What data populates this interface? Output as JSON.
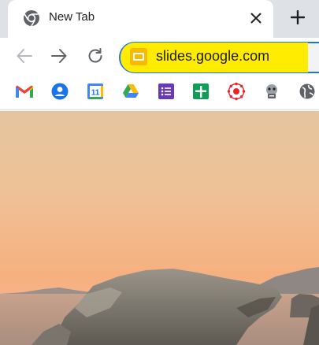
{
  "tab": {
    "title": "New Tab",
    "favicon": "chrome-icon"
  },
  "toolbar": {
    "back_icon": "back-arrow-icon",
    "forward_icon": "forward-arrow-icon",
    "reload_icon": "reload-icon"
  },
  "omnibox": {
    "url": "slides.google.com",
    "site_icon": "google-slides-icon",
    "highlight_color": "#ffec00"
  },
  "bookmarks": [
    {
      "icon": "gmail-icon"
    },
    {
      "icon": "google-account-icon"
    },
    {
      "icon": "google-calendar-icon",
      "text": "11"
    },
    {
      "icon": "google-drive-icon"
    },
    {
      "icon": "google-forms-icon"
    },
    {
      "icon": "google-sheets-icon"
    },
    {
      "icon": "canvas-icon"
    },
    {
      "icon": "extension-avatar-icon"
    },
    {
      "icon": "globe-icon"
    }
  ],
  "colors": {
    "tabstrip": "#dee1e6",
    "accent": "#1a73e8"
  }
}
